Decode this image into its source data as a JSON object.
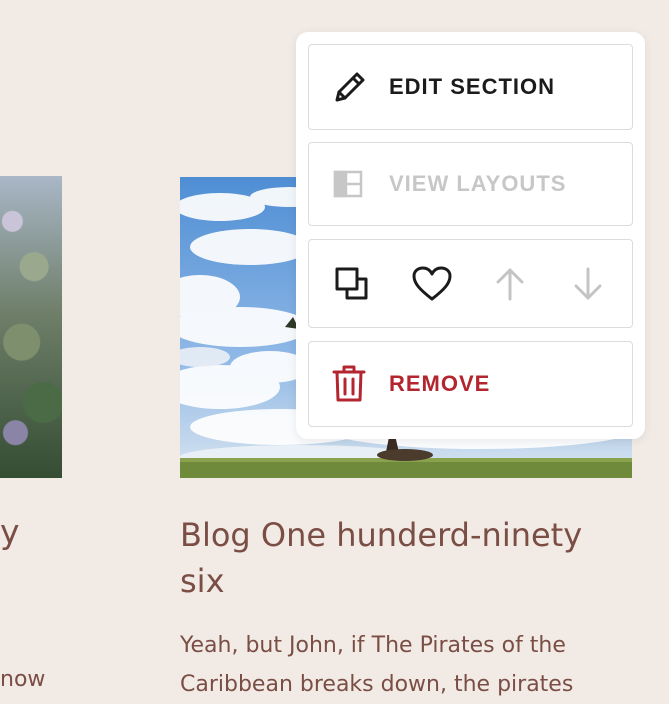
{
  "left_card": {
    "title_fragment": "y",
    "excerpt_fragment": "now"
  },
  "blog_card": {
    "title": "Blog One hunderd-ninety six",
    "excerpt": "Yeah, but John, if The Pirates of the Caribbean breaks down, the pirates"
  },
  "section_menu": {
    "edit_label": "EDIT SECTION",
    "view_layouts_label": "VIEW LAYOUTS",
    "remove_label": "REMOVE",
    "icons": {
      "edit": "pencil-icon",
      "view_layouts": "layout-icon",
      "duplicate": "duplicate-icon",
      "favorite": "heart-icon",
      "move_up": "arrow-up-icon",
      "move_down": "arrow-down-icon",
      "remove": "trash-icon"
    }
  },
  "colors": {
    "page_background": "#f2ebe5",
    "text_brown": "#7a4e45",
    "remove_red": "#b3262f",
    "disabled_gray": "#c7c7c7"
  }
}
